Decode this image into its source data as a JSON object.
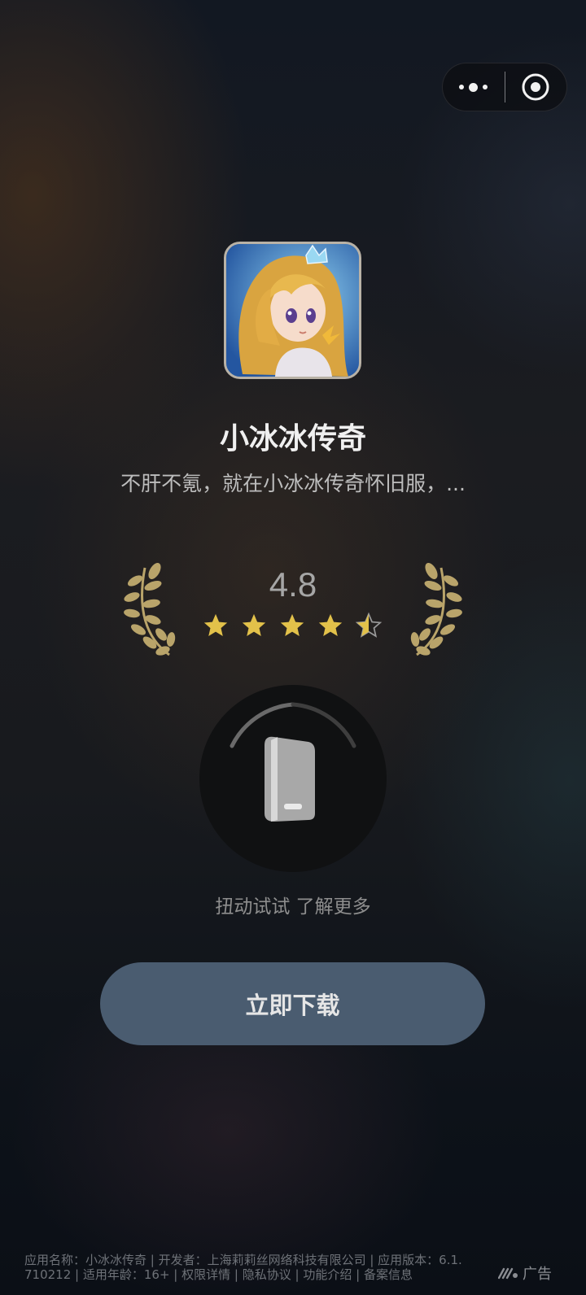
{
  "capsule": {
    "more_icon": "more-dots-icon",
    "close_icon": "target-close-icon"
  },
  "app": {
    "name": "小冰冰传奇",
    "description": "不肝不氪，就在小冰冰传奇怀旧服，...",
    "icon": "app-icon-character"
  },
  "rating": {
    "value": "4.8",
    "stars": 4.5
  },
  "shake": {
    "hint": "扭动试试 了解更多"
  },
  "download_button": {
    "label": "立即下载"
  },
  "footer": {
    "line1": "应用名称：小冰冰传奇 | 开发者：上海莉莉丝网络科技有限公司 | 应用版本：6.1.",
    "line2_version": "710212 | 适用年龄：16+ | ",
    "permissions": "权限详情",
    "sep1": " | ",
    "privacy": "隐私协议",
    "sep2": " | ",
    "features": "功能介绍",
    "sep3": " | ",
    "filing": "备案信息"
  },
  "ad_label": "广告",
  "colors": {
    "button": "#4a5c70",
    "star": "#e2c14a",
    "laurel": "#b9a46a"
  }
}
